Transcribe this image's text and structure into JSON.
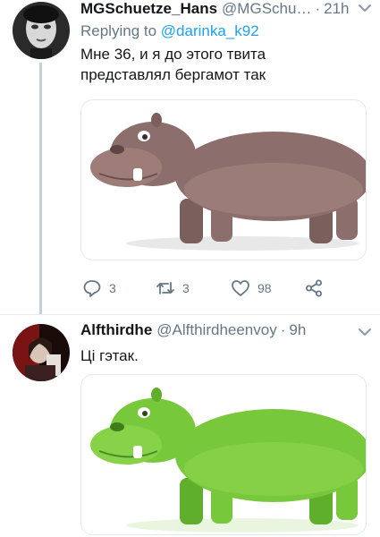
{
  "tweets": [
    {
      "author_name": "MGSchuetze_Hans",
      "author_handle": "@MGSchu…",
      "separator": "·",
      "time": "21h",
      "replying_prefix": "Replying to",
      "replying_handle": "@darinka_k92",
      "text_line1": "Мне 36, и я до этого твита",
      "text_line2": "представлял бергамот так",
      "image_icon": "hippo-photo",
      "stats": {
        "replies": "3",
        "retweets": "3",
        "likes": "98"
      }
    },
    {
      "author_name": "Alfthirdhe",
      "author_handle": "@Alfthirdheenvoy",
      "separator": "·",
      "time": "9h",
      "text_line1": "Ці гэтак.",
      "image_icon": "green-hippo-photo"
    }
  ],
  "colors": {
    "link": "#1da1f2",
    "secondary_text": "#657786",
    "thread_line": "#c4cfd6",
    "hippo_brown": "#8c6f6c",
    "hippo_green": "#78c83c"
  }
}
